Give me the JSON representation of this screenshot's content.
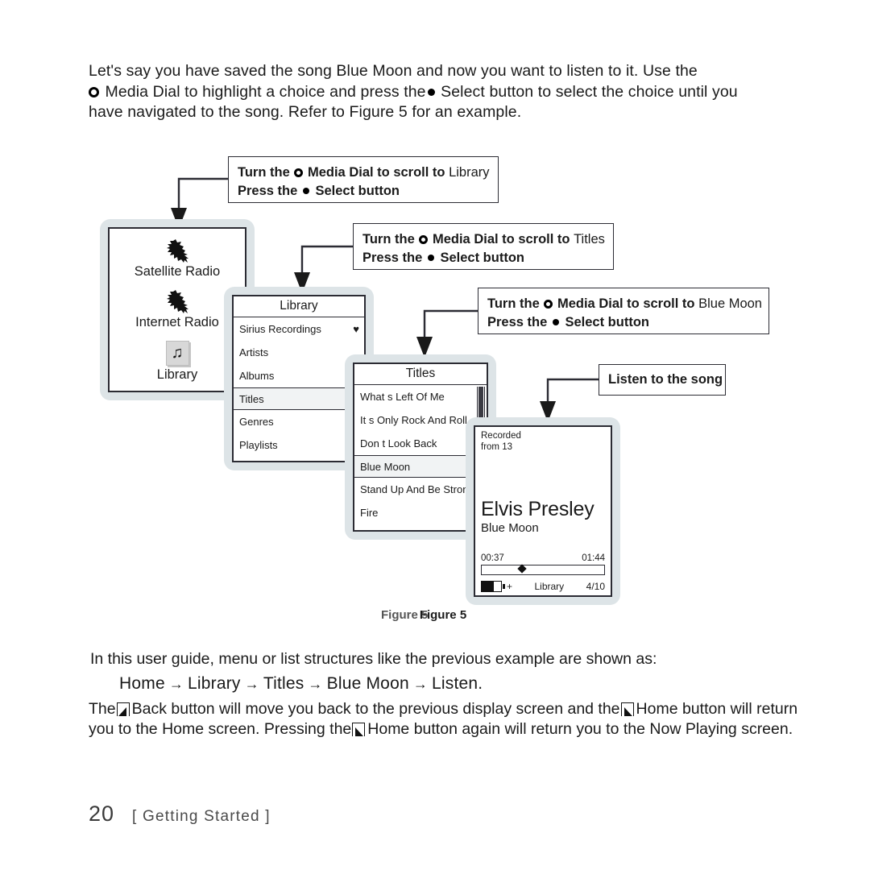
{
  "intro": {
    "line1_a": "Let's say you have saved the song ",
    "line1_b": "Blue Moon",
    "line1_c": " and now you want to listen to it. Use the",
    "line2_a": " Media Dial to highlight a choice and press the",
    "line2_b": " Select button to select the choice until you",
    "line3": "have navigated to the song. Refer to Figure 5 for an example."
  },
  "callouts": {
    "library": {
      "line1_pre": "Turn the",
      "line1_mid": "Media Dial to scroll to",
      "line1_target": "Library",
      "line2_pre": "Press the",
      "line2_post": "Select button"
    },
    "titles": {
      "line1_pre": "Turn the",
      "line1_mid": "Media Dial to scroll to",
      "line1_target": "Titles",
      "line2_pre": "Press the",
      "line2_post": "Select button"
    },
    "bluemoon": {
      "line1_pre": "Turn the",
      "line1_mid": "Media Dial to scroll to",
      "line1_target": "Blue Moon",
      "line2_pre": "Press the",
      "line2_post": "Select button"
    },
    "listen": {
      "label": "Listen to the song"
    }
  },
  "devices": {
    "home": {
      "items": [
        {
          "label": "Satellite Radio",
          "icon": "sirius-dog-icon"
        },
        {
          "label": "Internet Radio",
          "icon": "sirius-dog-icon"
        },
        {
          "label": "Library",
          "icon": "music-note-icon"
        }
      ]
    },
    "library": {
      "title": "Library",
      "rows": [
        {
          "label": "Sirius Recordings",
          "badge": "♥",
          "selected": false
        },
        {
          "label": "Artists",
          "badge": "",
          "selected": false
        },
        {
          "label": "Albums",
          "badge": "",
          "selected": false
        },
        {
          "label": "Titles",
          "badge": "",
          "selected": true
        },
        {
          "label": "Genres",
          "badge": "",
          "selected": false
        },
        {
          "label": "Playlists",
          "badge": "",
          "selected": false
        }
      ]
    },
    "titles": {
      "title": "Titles",
      "rows": [
        {
          "label": "What s Left Of Me",
          "badge": "",
          "selected": false
        },
        {
          "label": "It s Only Rock And Roll",
          "badge": "♥",
          "selected": false
        },
        {
          "label": "Don t Look Back",
          "badge": "",
          "selected": false
        },
        {
          "label": "Blue Moon",
          "badge": "",
          "selected": true
        },
        {
          "label": "Stand Up And Be Strong",
          "badge": "",
          "selected": false
        },
        {
          "label": "Fire",
          "badge": "",
          "selected": false
        }
      ]
    },
    "now_playing": {
      "recorded_line1": "Recorded",
      "recorded_line2": "from 13",
      "artist": "Elvis Presley",
      "song": "Blue Moon",
      "elapsed": "00:37",
      "total": "01:44",
      "source": "Library",
      "track_position": "4/10",
      "battery_plus": "+"
    }
  },
  "figure_caption": {
    "text": "Figure 5"
  },
  "outro": {
    "line1": "In this user guide, menu or list structures like the previous example are shown as:",
    "path": [
      "Home",
      "Library",
      "Titles",
      "Blue Moon",
      "Listen."
    ],
    "path_arrow": "→",
    "para2_a": "The",
    "para2_b": "Back button will move you back to the previous display screen and the",
    "para2_c": "Home button",
    "para2_d": "will return you to the Home screen. Pressing the",
    "para2_e": "Home button again will return you to the",
    "para2_f": "Now Playing screen."
  },
  "footer": {
    "page_number": "20",
    "section": "[ Getting Started ]"
  },
  "colors": {
    "ink": "#1a1a1a",
    "device_shell": "#dde4e7",
    "screen_border": "#2b2b33",
    "highlight_row": "#f1f3f4",
    "footer_text": "#3a3a3a"
  }
}
